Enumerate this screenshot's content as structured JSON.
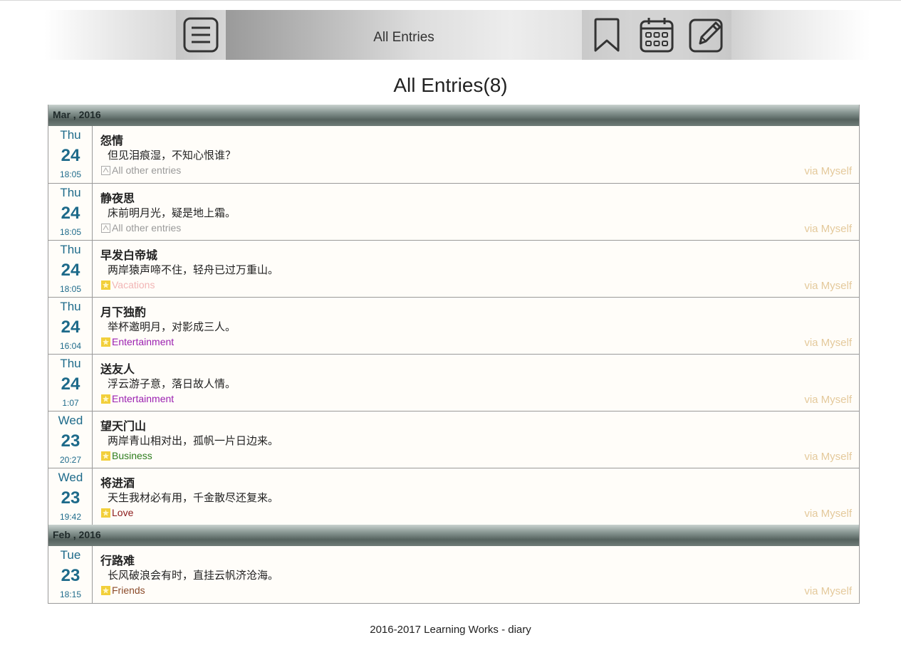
{
  "header": {
    "title": "All Entries"
  },
  "page_title": "All Entries(8)",
  "icons": {
    "menu": "menu-icon",
    "bookmark": "bookmark-icon",
    "calendar": "calendar-icon",
    "edit": "edit-icon"
  },
  "colors": {
    "date_text": "#1d6a8a",
    "via_text": "#e4c99b",
    "cat_uncategorized": "#9a9a9a",
    "cat_vacations": "#f2b5b5",
    "cat_entertainment": "#9b1fb0",
    "cat_business": "#2e7d1e",
    "cat_love": "#8b1a1a",
    "cat_friends": "#8b4b2a"
  },
  "months": [
    {
      "label": "Mar , 2016",
      "entries": [
        {
          "dow": "Thu",
          "day": "24",
          "time": "18:05",
          "title": "怨情",
          "body": "但见泪痕湿，不知心恨谁？",
          "category": "All other entries",
          "cat_style": "uncat",
          "via": "via Myself"
        },
        {
          "dow": "Thu",
          "day": "24",
          "time": "18:05",
          "title": "静夜思",
          "body": "床前明月光，疑是地上霜。",
          "category": "All other entries",
          "cat_style": "uncat",
          "via": "via Myself"
        },
        {
          "dow": "Thu",
          "day": "24",
          "time": "18:05",
          "title": "早发白帝城",
          "body": "两岸猿声啼不住，轻舟已过万重山。",
          "category": "Vacations",
          "cat_style": "vacations",
          "via": "via Myself"
        },
        {
          "dow": "Thu",
          "day": "24",
          "time": "16:04",
          "title": "月下独酌",
          "body": "举杯邀明月，对影成三人。",
          "category": "Entertainment",
          "cat_style": "entertainment",
          "via": "via Myself"
        },
        {
          "dow": "Thu",
          "day": "24",
          "time": "1:07",
          "title": "送友人",
          "body": "浮云游子意，落日故人情。",
          "category": "Entertainment",
          "cat_style": "entertainment",
          "via": "via Myself"
        },
        {
          "dow": "Wed",
          "day": "23",
          "time": "20:27",
          "title": "望天门山",
          "body": "两岸青山相对出，孤帆一片日边来。",
          "category": "Business",
          "cat_style": "business",
          "via": "via Myself"
        },
        {
          "dow": "Wed",
          "day": "23",
          "time": "19:42",
          "title": "将进酒",
          "body": "天生我材必有用，千金散尽还复来。",
          "category": "Love",
          "cat_style": "love",
          "via": "via Myself"
        }
      ]
    },
    {
      "label": "Feb , 2016",
      "entries": [
        {
          "dow": "Tue",
          "day": "23",
          "time": "18:15",
          "title": "行路难",
          "body": "长风破浪会有时，直挂云帆济沧海。",
          "category": "Friends",
          "cat_style": "friends",
          "via": "via Myself"
        }
      ]
    }
  ],
  "footer": "2016-2017 Learning Works - diary"
}
